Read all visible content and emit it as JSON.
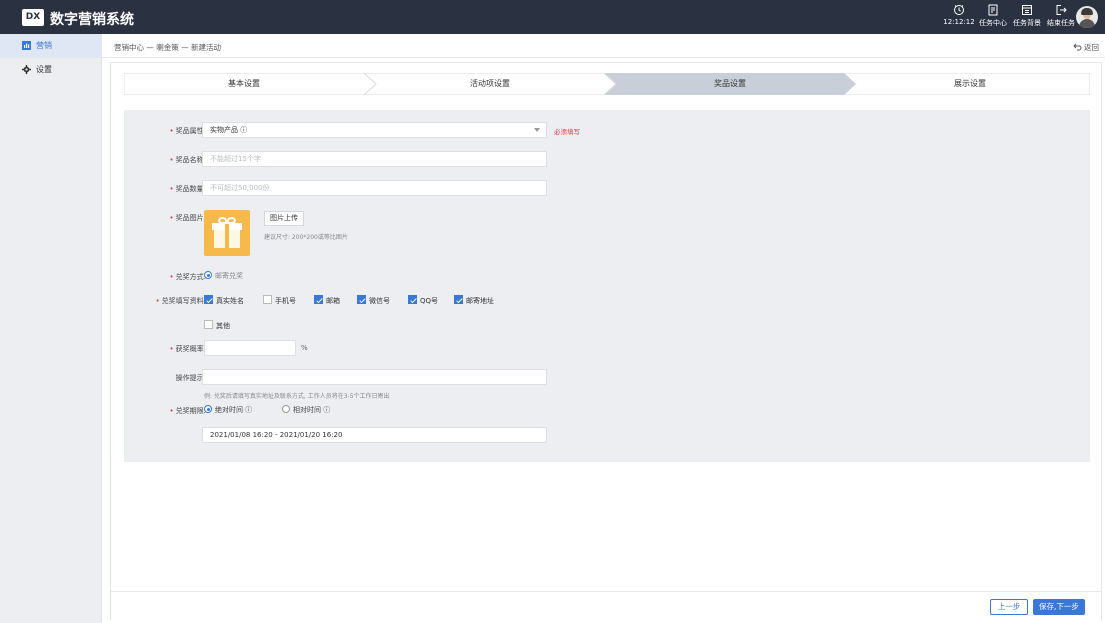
{
  "app": {
    "logo": "DX",
    "title": "数字营销系统"
  },
  "topbar": {
    "clock": {
      "icon": "clock-icon",
      "label": "12:12:12"
    },
    "actions": [
      {
        "icon": "task-center-icon",
        "label": "任务中心"
      },
      {
        "icon": "task-background-icon",
        "label": "任务背景"
      },
      {
        "icon": "end-task-icon",
        "label": "结束任务"
      }
    ]
  },
  "sidebar": {
    "items": [
      {
        "icon": "marketing-icon",
        "label": "营销",
        "active": true
      },
      {
        "icon": "gear-icon",
        "label": "设置",
        "active": false
      }
    ]
  },
  "breadcrumb": {
    "text": "营销中心 — 喇金策 — 新建活动",
    "back": "返回"
  },
  "steps": [
    "基本设置",
    "活动项设置",
    "奖品设置",
    "展示设置"
  ],
  "active_step": 2,
  "form": {
    "prize_attr": {
      "label": "奖品属性:",
      "value": "实物产品 ⓘ",
      "required_hint": "必须填写"
    },
    "prize_name": {
      "label": "奖品名称:",
      "placeholder": "不能超过15个字"
    },
    "prize_qty": {
      "label": "奖品数量:",
      "placeholder": "不可超过50,000份"
    },
    "prize_image": {
      "label": "奖品图片:",
      "upload": "图片上传",
      "hint": "建议尺寸: 200*200或等比图片"
    },
    "redeem_method": {
      "label": "兑奖方式:",
      "option": "邮寄兑奖"
    },
    "fill_info": {
      "label": "兑奖填写资料:",
      "options": [
        {
          "label": "真实姓名",
          "checked": true
        },
        {
          "label": "手机号",
          "checked": false
        },
        {
          "label": "邮箱",
          "checked": true
        },
        {
          "label": "微信号",
          "checked": true
        },
        {
          "label": "QQ号",
          "checked": true
        },
        {
          "label": "邮寄地址",
          "checked": true
        },
        {
          "label": "其他",
          "checked": false
        }
      ]
    },
    "win_rate": {
      "label": "获奖概率:",
      "unit": "%"
    },
    "op_tip": {
      "label": "操作提示:",
      "example": "例: 兑奖后请填写真实地址及联系方式, 工作人员将在3-5个工作日寄出"
    },
    "redeem_period": {
      "label": "兑奖期限:",
      "options": [
        {
          "label": "绝对时间 ⓘ",
          "selected": true
        },
        {
          "label": "相对时间 ⓘ",
          "selected": false
        }
      ],
      "range": "2021/01/08 16:20 - 2021/01/20 16:20"
    }
  },
  "footer": {
    "prev": "上一步",
    "next": "保存,下一步"
  },
  "colors": {
    "topbar": "#2a3140",
    "accent": "#3a78d8",
    "required": "#e03a3a",
    "panel": "#eceef2"
  }
}
